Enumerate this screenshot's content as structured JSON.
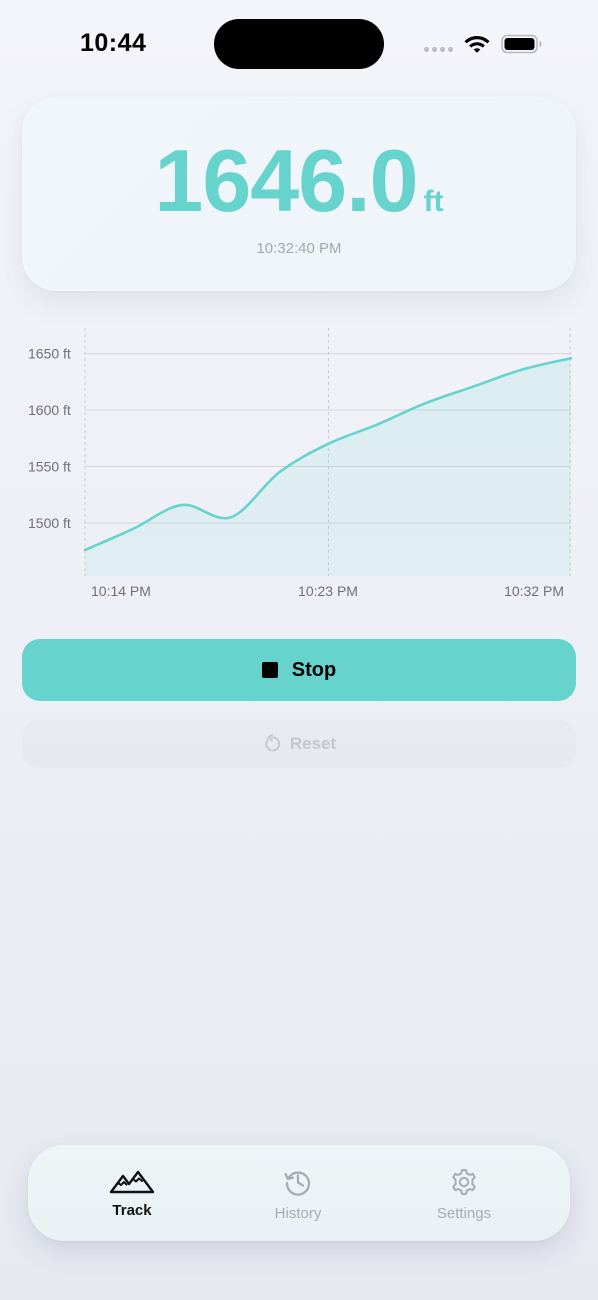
{
  "status_bar": {
    "time": "10:44"
  },
  "altitude": {
    "value": "1646.0",
    "unit": "ft",
    "timestamp": "10:32:40 PM",
    "color": "#66d3cc"
  },
  "chart_data": {
    "type": "area",
    "y_unit": "ft",
    "y_ticks": [
      1500,
      1550,
      1600,
      1650
    ],
    "y_tick_labels": [
      "1500 ft",
      "1550 ft",
      "1600 ft",
      "1650 ft"
    ],
    "x_tick_labels": [
      "10:14 PM",
      "10:23 PM",
      "10:32 PM"
    ],
    "ylim": [
      1453,
      1671
    ],
    "x": [
      "10:14 PM",
      "10:16 PM",
      "10:18 PM",
      "10:20 PM",
      "10:22 PM",
      "10:24 PM",
      "10:26 PM",
      "10:28 PM",
      "10:30 PM",
      "10:32 PM",
      "10:32:40 PM"
    ],
    "values": [
      1476,
      1495,
      1516,
      1505,
      1545,
      1570,
      1587,
      1606,
      1621,
      1636,
      1646
    ],
    "grid": true,
    "line_color": "#66d3cc"
  },
  "controls": {
    "stop_label": "Stop",
    "reset_label": "Reset"
  },
  "tabs": [
    {
      "label": "Track",
      "icon": "mountains-icon",
      "active": true
    },
    {
      "label": "History",
      "icon": "history-icon",
      "active": false
    },
    {
      "label": "Settings",
      "icon": "gear-icon",
      "active": false
    }
  ]
}
